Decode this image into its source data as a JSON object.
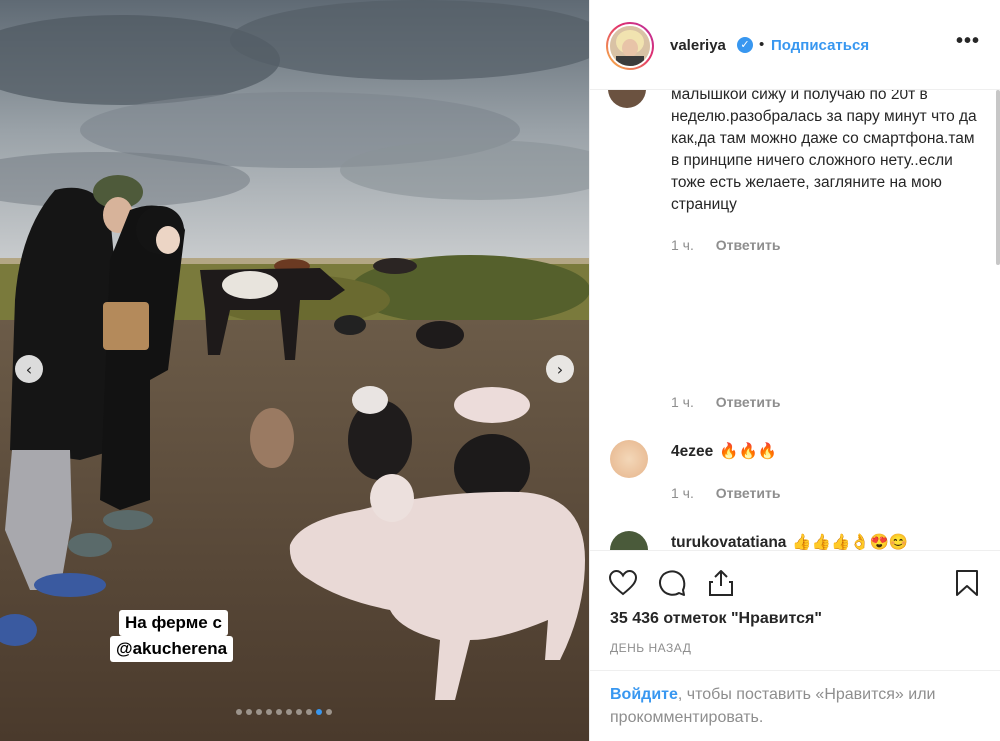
{
  "post": {
    "username": "valeriya",
    "separator": "•",
    "follow_label": "Подписаться",
    "more_label": "•••"
  },
  "photo": {
    "tag_line1": "На ферме с",
    "tag_line2": "@akucherena",
    "arrow_left": "‹",
    "arrow_right": "›",
    "dot_count": 10,
    "active_dot": 8
  },
  "comments": [
    {
      "text": "малышкой сижу и получаю по 20т в неделю.разобралась за пару минут что да как,да там можно даже со смартфона.там в принципе ничего сложного нету..если тоже есть желаете, загляните на мою страницу",
      "time": "1 ч.",
      "reply": "Ответить"
    },
    {
      "text": "",
      "time": "1 ч.",
      "reply": "Ответить"
    },
    {
      "user": "4ezee",
      "text": "🔥🔥🔥",
      "time": "1 ч.",
      "reply": "Ответить"
    },
    {
      "user": "turukovatatiana",
      "text": "👍👍👍👌😍😊"
    }
  ],
  "stats": {
    "likes": "35 436 отметок \"Нравится\"",
    "date": "ДЕНЬ НАЗАД"
  },
  "login": {
    "link": "Войдите",
    "rest": ", чтобы поставить «Нравится» или прокомментировать."
  },
  "colors": {
    "accent": "#3897f0",
    "muted": "#8e8e8e",
    "text": "#262626"
  },
  "icons": [
    "heart-icon",
    "comment-icon",
    "share-icon",
    "bookmark-icon",
    "verified-icon",
    "more-icon"
  ]
}
